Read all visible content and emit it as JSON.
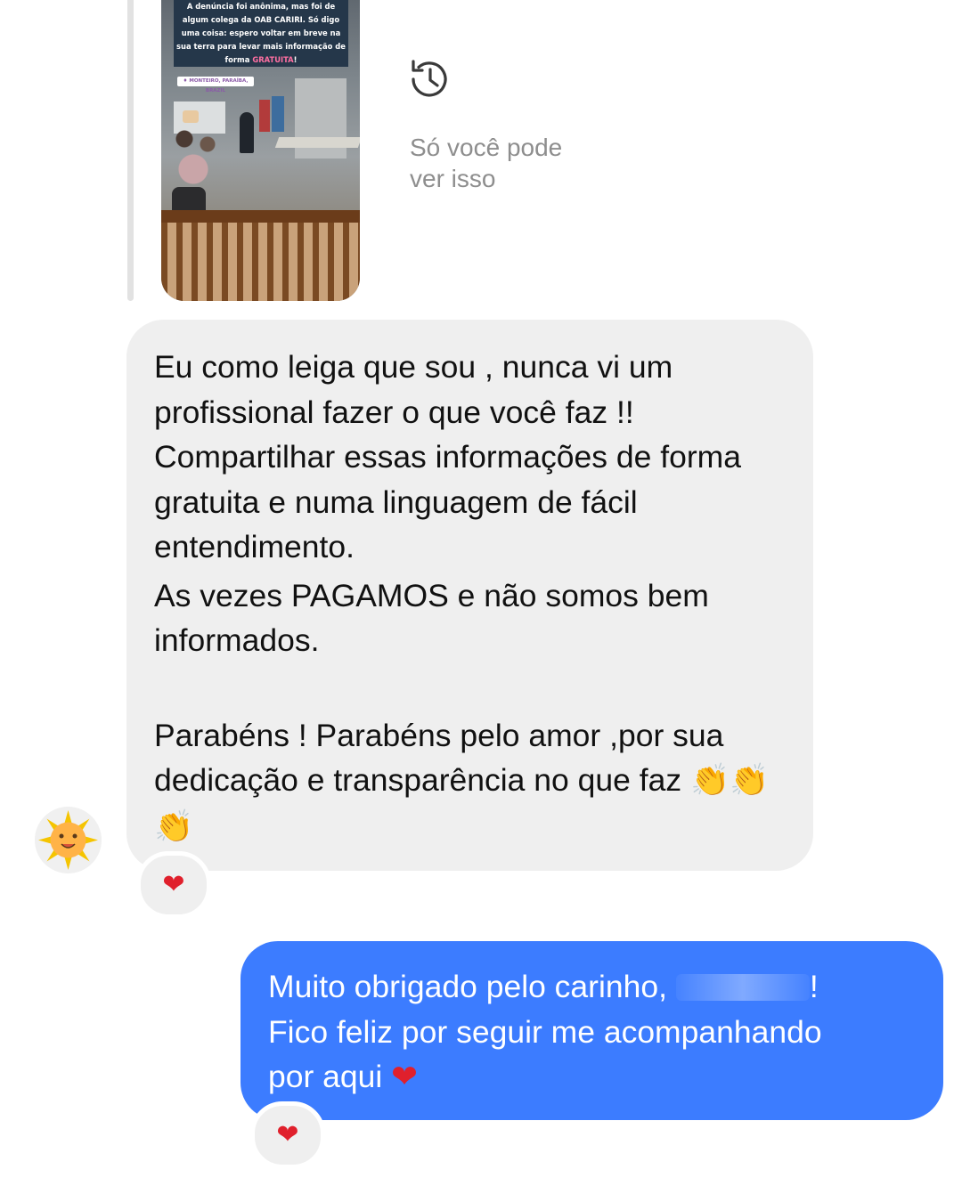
{
  "story": {
    "caption_pre": "A denúncia foi anônima, mas foi de algum colega da OAB CARIRI. Só digo uma coisa: espero voltar em breve na sua terra para levar mais informação de forma ",
    "caption_highlight": "GRATUITA",
    "caption_post": "!",
    "location_tag": "♦ MONTEIRO, PARAÍBA, BRAZIL",
    "visibility_line1": "Só você pode",
    "visibility_line2": "ver isso"
  },
  "incoming": {
    "paragraph1": "Eu como leiga que sou , nunca vi um profissional fazer o que você faz !! Compartilhar essas informações de forma gratuita e numa linguagem de fácil entendimento.",
    "paragraph2": "As vezes PAGAMOS e não somos bem informados.",
    "paragraph3": "Parabéns ! Parabéns pelo  amor ,por sua dedicação e transparência no que faz",
    "paragraph3_emoji": "👏👏👏",
    "reaction": "❤"
  },
  "outgoing": {
    "line1_pre": "Muito obrigado pelo carinho, ",
    "line1_post": "!",
    "line2": "Fico feliz por seguir me acompanhando",
    "line3": "por aqui",
    "line3_emoji": "❤",
    "reaction": "❤"
  },
  "icons": {
    "history": "history-icon",
    "avatar": "sun-avatar-icon",
    "heart": "heart-icon",
    "clap": "clapping-hands-icon"
  },
  "colors": {
    "outgoing_bubble": "#3c7cff",
    "incoming_bubble": "#efefef",
    "heart": "#e0202c"
  }
}
